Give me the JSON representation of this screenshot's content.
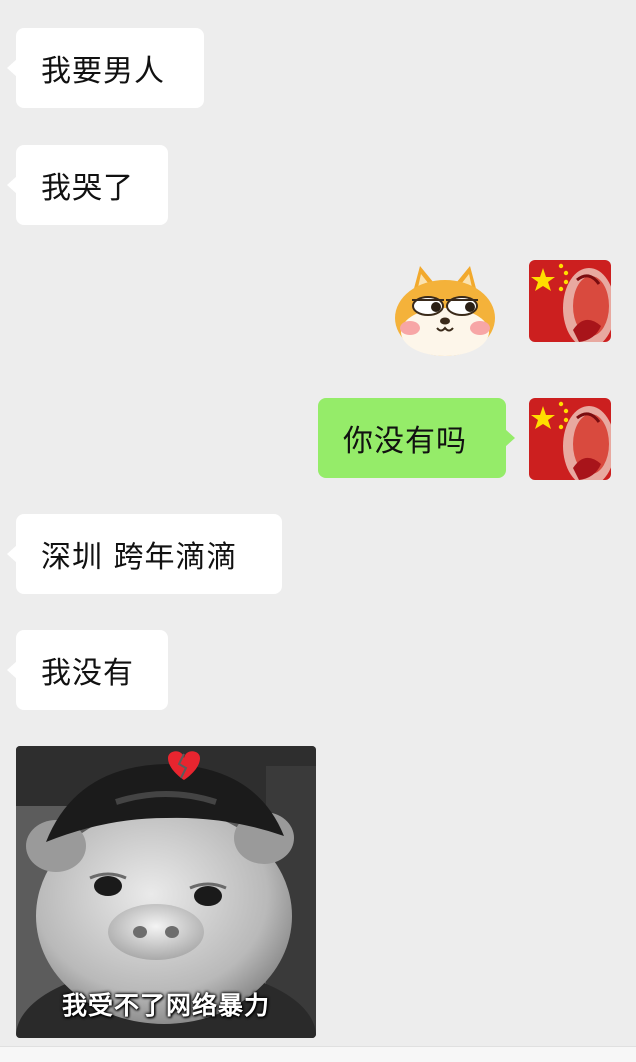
{
  "chat": {
    "messages": [
      {
        "side": "left",
        "type": "text",
        "text": "我要男人"
      },
      {
        "side": "left",
        "type": "text",
        "text": "我哭了"
      },
      {
        "side": "right",
        "type": "sticker",
        "icon": "shiba-dog-sticker"
      },
      {
        "side": "right",
        "type": "text",
        "text": "你没有吗"
      },
      {
        "side": "left",
        "type": "text",
        "text": "深圳 跨年滴滴"
      },
      {
        "side": "left",
        "type": "text",
        "text": "我没有"
      },
      {
        "side": "left",
        "type": "image",
        "caption": "我受不了网络暴力",
        "icon": "pig-meme-image"
      }
    ]
  },
  "colors": {
    "background": "#ededed",
    "received_bubble": "#ffffff",
    "sent_bubble": "#95ec69",
    "avatar_red": "#cc1f1f",
    "flag_star": "#ffde00"
  }
}
